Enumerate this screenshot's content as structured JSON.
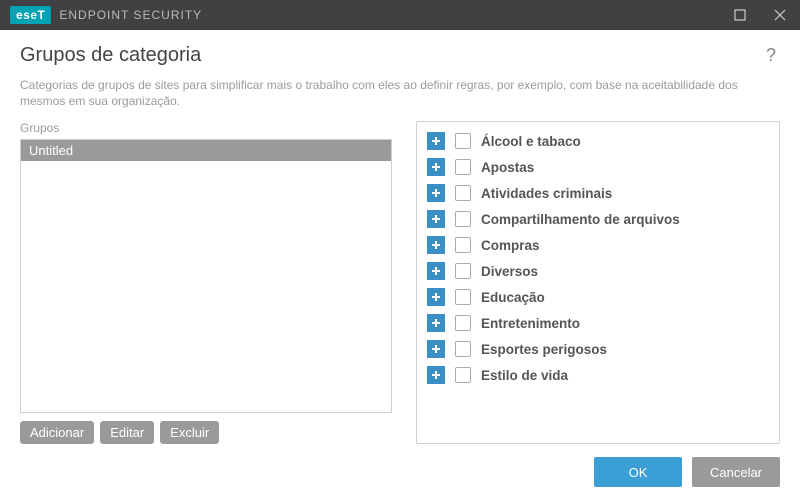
{
  "titlebar": {
    "logo_text": "eseT",
    "app_title": "ENDPOINT SECURITY"
  },
  "page": {
    "title": "Grupos de categoria",
    "help_symbol": "?",
    "description": "Categorias de grupos de sites para simplificar mais o trabalho com eles ao definir regras, por exemplo, com base na aceitabilidade dos mesmos em sua organização."
  },
  "left": {
    "label": "Grupos",
    "items": [
      {
        "label": "Untitled",
        "selected": true
      }
    ],
    "actions": {
      "add": "Adicionar",
      "edit": "Editar",
      "delete": "Excluir"
    }
  },
  "categories": [
    {
      "label": "Álcool e tabaco"
    },
    {
      "label": "Apostas"
    },
    {
      "label": "Atividades criminais"
    },
    {
      "label": "Compartilhamento de arquivos"
    },
    {
      "label": "Compras"
    },
    {
      "label": "Diversos"
    },
    {
      "label": "Educação"
    },
    {
      "label": "Entretenimento"
    },
    {
      "label": "Esportes perigosos"
    },
    {
      "label": "Estilo de vida"
    }
  ],
  "footer": {
    "ok": "OK",
    "cancel": "Cancelar"
  }
}
